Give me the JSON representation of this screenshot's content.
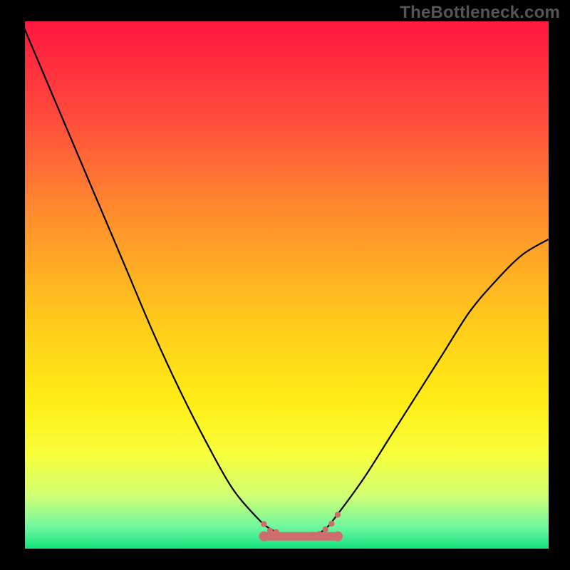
{
  "watermark": "TheBottleneck.com",
  "chart_data": {
    "type": "line",
    "title": "",
    "xlabel": "",
    "ylabel": "",
    "x": [
      0.0,
      0.05,
      0.1,
      0.15,
      0.2,
      0.25,
      0.3,
      0.35,
      0.4,
      0.45,
      0.475,
      0.5,
      0.525,
      0.55,
      0.575,
      0.6,
      0.65,
      0.7,
      0.75,
      0.8,
      0.85,
      0.9,
      0.95,
      1.0
    ],
    "values": [
      1.0,
      0.88,
      0.76,
      0.64,
      0.52,
      0.4,
      0.29,
      0.19,
      0.1,
      0.04,
      0.02,
      0.01,
      0.01,
      0.01,
      0.02,
      0.05,
      0.12,
      0.2,
      0.28,
      0.36,
      0.44,
      0.5,
      0.55,
      0.58
    ],
    "xlim": [
      0,
      1
    ],
    "ylim": [
      0,
      1
    ],
    "annotations": {
      "marker_range_x": [
        0.46,
        0.6
      ],
      "marker_color": "#cf6c6c",
      "gradient_stops": [
        "#ff173f",
        "#ff8b2e",
        "#ffed15",
        "#14e27a"
      ]
    }
  }
}
